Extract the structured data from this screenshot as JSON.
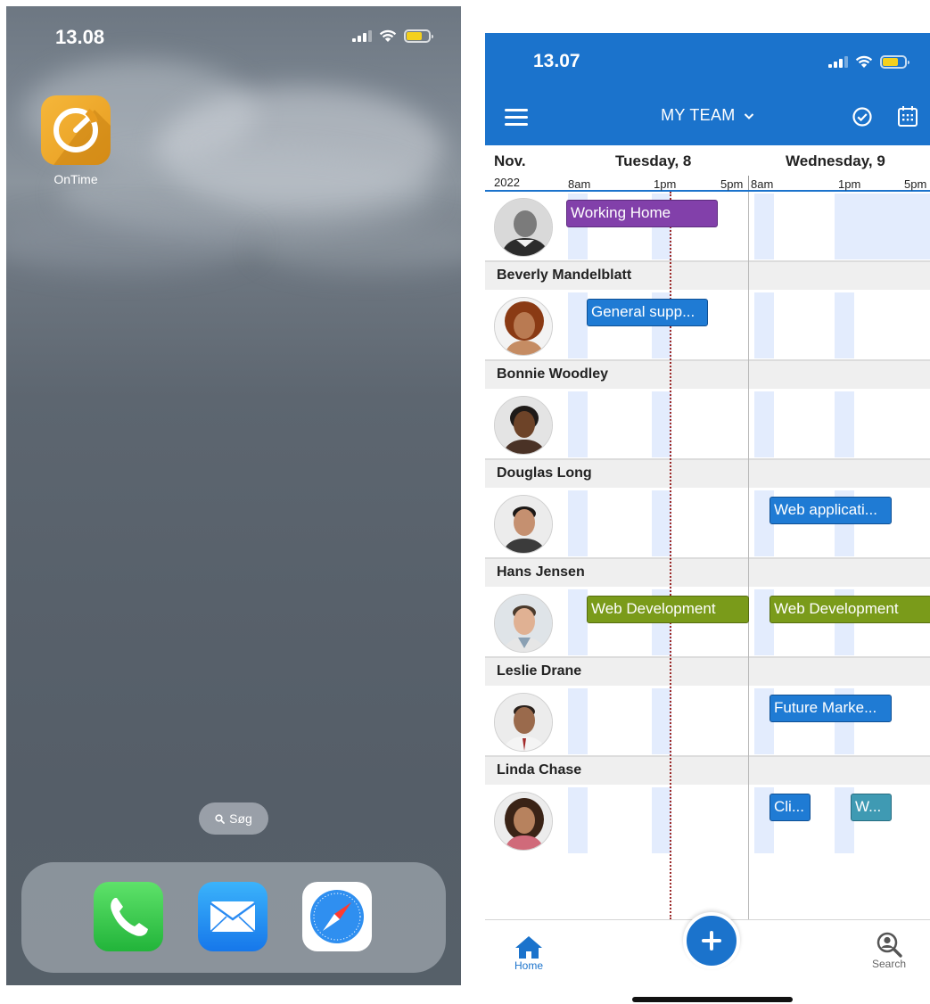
{
  "home_screen": {
    "status_time": "13.08",
    "apps": [
      {
        "label": "OnTime",
        "icon": "ontime-logo-icon"
      }
    ],
    "search_label": "Søg",
    "dock": [
      {
        "name": "phone",
        "icon": "phone-icon"
      },
      {
        "name": "mail",
        "icon": "mail-icon"
      },
      {
        "name": "safari",
        "icon": "safari-compass-icon"
      }
    ]
  },
  "ontime_app": {
    "status_time": "13.07",
    "header": {
      "team_selector": "MY TEAM",
      "dropdown_icon": "chevron-down-icon",
      "menu_icon": "hamburger-icon",
      "check_icon": "check-circle-icon",
      "calendar_icon": "calendar-icon"
    },
    "timeline": {
      "month": "Nov.",
      "year": "2022",
      "days": [
        {
          "label": "Tuesday, 8",
          "ticks": [
            "8am",
            "1pm",
            "5pm"
          ]
        },
        {
          "label": "Wednesday, 9",
          "ticks": [
            "8am",
            "1pm",
            "5pm"
          ]
        }
      ]
    },
    "people": [
      {
        "name": "",
        "events": [
          "Working Home"
        ]
      },
      {
        "name": "Beverly Mandelblatt",
        "events": [
          "General supp..."
        ]
      },
      {
        "name": "Bonnie Woodley",
        "events": []
      },
      {
        "name": "Douglas Long",
        "events": [
          "Web applicati..."
        ]
      },
      {
        "name": "Hans Jensen",
        "events": [
          "Web Development",
          "Web Development"
        ]
      },
      {
        "name": "Leslie Drane",
        "events": [
          "Future Marke..."
        ]
      },
      {
        "name": "Linda Chase",
        "events": [
          "Cli...",
          "W..."
        ]
      }
    ],
    "bottom_nav": {
      "home": "Home",
      "search": "Search"
    },
    "colors": {
      "primary": "#1b73cc",
      "purple_event": "#8240aa",
      "blue_event": "#1f7bd4",
      "green_event": "#7a9b1a",
      "teal_event": "#3f9ab3",
      "shade": "#e3ecfd"
    }
  }
}
